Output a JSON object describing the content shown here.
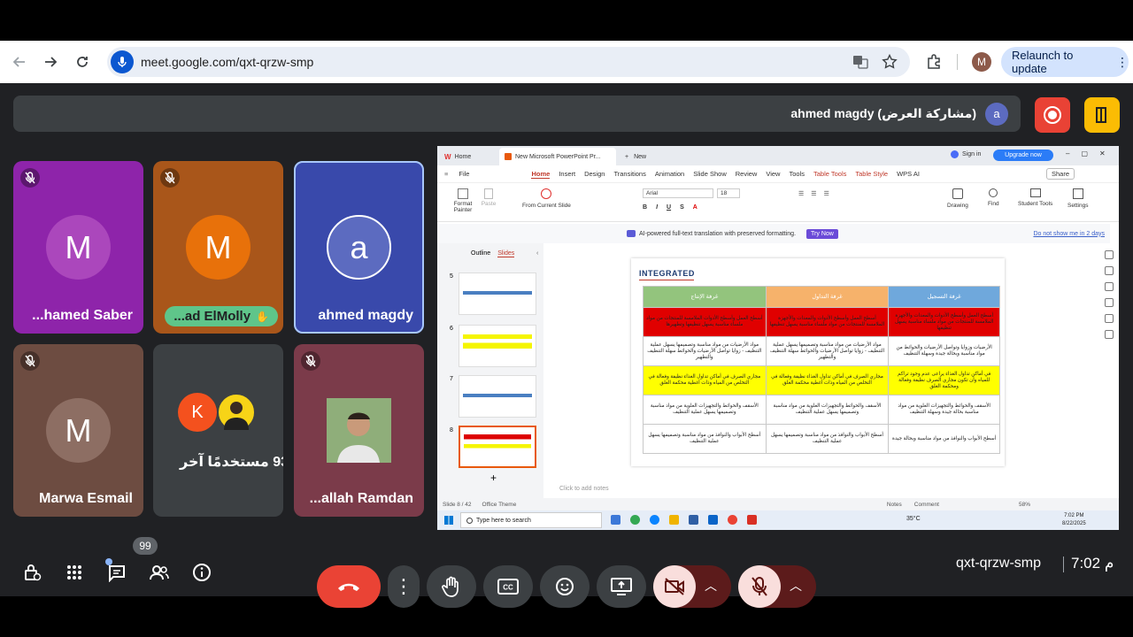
{
  "browser": {
    "url": "meet.google.com/qxt-qrzw-smp",
    "relaunch_label": "Relaunch to update",
    "profile_initial": "M"
  },
  "banner": {
    "presenter_text": "ahmed magdy (مشاركة العرض)",
    "presenter_initial": "a"
  },
  "participants": [
    {
      "name": "...hamed Saber",
      "initial": "M",
      "color": "#8e24aa",
      "avatar_color": "#ab47bc",
      "muted": true
    },
    {
      "name": "...ad ElMolly",
      "initial": "M",
      "color": "#a9561a",
      "avatar_color": "#e8710a",
      "muted": true,
      "hand_raised": true
    },
    {
      "name": "ahmed magdy",
      "initial": "a",
      "color": "#3949ab",
      "avatar_color": "#5c6bc0",
      "muted": false,
      "active": true
    },
    {
      "name": "Marwa Esmail",
      "initial": "M",
      "color": "#6d4c41",
      "avatar_color": "#8d6e63",
      "muted": true
    },
    {
      "name": "93 مستخدمًا آخر",
      "initial": "K",
      "color": "#3c4043",
      "avatar_color": "#f4511e",
      "muted": false
    },
    {
      "name": "...allah Ramdan",
      "initial": "",
      "color": "#7b3b4a",
      "avatar_color": "#9aa",
      "muted": true
    }
  ],
  "presentation": {
    "tabs": [
      "Home",
      "New Microsoft PowerPoint Pr...",
      "New"
    ],
    "sign_in": "Sign in",
    "upgrade": "Upgrade now",
    "menu": [
      "File",
      "Home",
      "Insert",
      "Design",
      "Transitions",
      "Animation",
      "Slide Show",
      "Review",
      "View",
      "Tools",
      "Table Tools",
      "Table Style",
      "WPS AI"
    ],
    "share": "Share",
    "ribbon": {
      "format_painter": "Format Painter",
      "paste": "Paste",
      "from_current": "From Current Slide",
      "font": "Arial",
      "font_size": "18",
      "drawing": "Drawing",
      "find": "Find",
      "student_tools": "Student Tools",
      "settings": "Settings"
    },
    "notice": "AI-powered full-text translation with preserved formatting.",
    "try_now": "Try Now",
    "dont_show": "Do not show me in 2 days",
    "left_tabs": [
      "Outline",
      "Slides"
    ],
    "thumb_numbers": [
      "5",
      "6",
      "7",
      "8"
    ],
    "logo": "INTEGRATED",
    "table_headers": [
      "غرفة التسجيل",
      "غرفة التداول",
      "غرفة الإنتاج"
    ],
    "table_rows": [
      {
        "bg": "#e00000",
        "cells": [
          "أسطح العمل وأسطح الأدوات والمعدات والأجهزة الملامسة للمنتجات من مواد ملساء مناسبة يسهل تنظيفها",
          "أسطح العمل وأسطح الأدوات والمعدات والأجهزة الملامسة للمنتجات من مواد ملساء مناسبة يسهل تنظيفها",
          "أسطح العمل وأسطح الأدوات الملامسة للمنتجات من مواد ملساء مناسبة يسهل تنظيفها وتطهيرها"
        ]
      },
      {
        "bg": "#ffffff",
        "cells": [
          "الأرضيات وزوايا وتواصل الأرضيات والحوائط من مواد مناسبة وبحالة جيدة وسهلة التنظيف",
          "مواد الأرضيات من مواد مناسبة وتصميمها يسهل عملية التنظيف - زوايا تواصل الأرضيات والحوائط سهلة التنظيف والتطهير",
          "مواد الأرضيات من مواد مناسبة وتصميمها يسهل عملية التنظيف - زوايا تواصل الأرضيات والحوائط سهلة التنظيف والتطهير"
        ]
      },
      {
        "bg": "#ffff00",
        "cells": [
          "في أماكن تداول الغذاء يراعى عدم وجود تراكم للمياه وأن تكون مجاري الصرف نظيفة وفعالة ومحكمة الغلق",
          "مجاري الصرف في أماكن تداول الغذاء نظيفة وفعالة في التخلص من المياه وذات أغطية محكمة الغلق",
          "مجاري الصرف في أماكن تداول الغذاء نظيفة وفعالة في التخلص من المياه وذات أغطية محكمة الغلق"
        ]
      },
      {
        "bg": "#ffffff",
        "cells": [
          "الأسقف والحوائط والتجهيزات العلوية من مواد مناسبة بحالة جيدة وسهلة التنظيف",
          "الأسقف والحوائط والتجهيزات العلوية من مواد مناسبة وتصميمها يسهل عملية التنظيف",
          "الأسقف والحوائط والتجهيزات العلوية من مواد مناسبة وتصميمها يسهل عملية التنظيف"
        ]
      },
      {
        "bg": "#ffffff",
        "cells": [
          "أسطح الأبواب والنوافذ من مواد مناسبة وبحالة جيدة",
          "أسطح الأبواب والنوافذ من مواد مناسبة وتصميمها يسهل عملية التنظيف",
          "أسطح الأبواب والنوافذ من مواد مناسبة وتصميمها يسهل عملية التنظيف"
        ]
      }
    ],
    "header_colors": [
      "#6fa8dc",
      "#f6b26b",
      "#93c47d"
    ],
    "click_notes": "Click to add notes",
    "status": {
      "slide": "Slide 8 / 42",
      "theme": "Office Theme",
      "notes": "Notes",
      "comment": "Comment",
      "zoom": "58%"
    },
    "taskbar": {
      "search": "Type here to search",
      "temp": "35°C",
      "time": "7:02 PM",
      "date": "8/22/2025"
    }
  },
  "bottom": {
    "participants_count": "99",
    "meeting_code": "qxt-qrzw-smp",
    "time": "7:02 م"
  }
}
